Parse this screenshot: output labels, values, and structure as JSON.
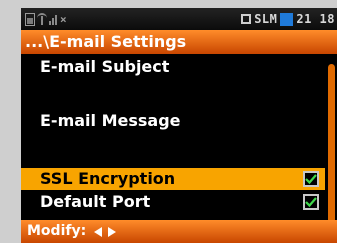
{
  "statusbar": {
    "mode_label": "SLM",
    "time": "21 18",
    "icons": [
      "battery-icon",
      "antenna-icon",
      "signal-icon",
      "mode-indicator-icon",
      "record-indicator-icon"
    ],
    "signal_mark": "×"
  },
  "title": "...\\E-mail Settings",
  "menu": {
    "items": [
      {
        "label": "E-mail Subject",
        "checked": null,
        "selected": false
      },
      {
        "label": "E-mail Message",
        "checked": null,
        "selected": false
      },
      {
        "label": "SSL Encryption",
        "checked": true,
        "selected": true
      },
      {
        "label": "Default Port",
        "checked": true,
        "selected": false
      }
    ]
  },
  "footer": {
    "label": "Modify:",
    "icons": [
      "arrow-left-icon",
      "arrow-right-icon"
    ]
  },
  "colors": {
    "accent_orange": "#e06a00",
    "selection_yellow": "#f8a400",
    "check_green": "#3fd84a",
    "background": "#000000",
    "record_blue": "#1f7ad9"
  }
}
